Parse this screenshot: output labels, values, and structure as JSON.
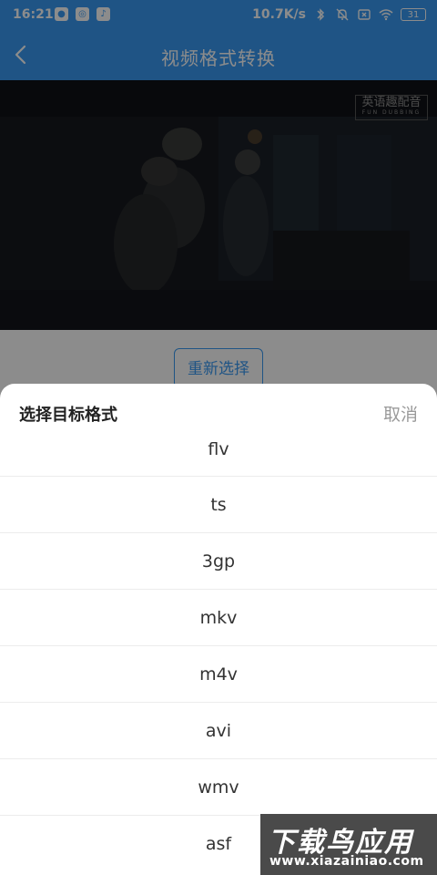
{
  "status_bar": {
    "time": "16:21",
    "network_speed": "10.7K/s",
    "battery": "31",
    "app_icons": [
      "app-icon-1",
      "app-icon-2",
      "tiktok-icon"
    ]
  },
  "app_bar": {
    "title": "视频格式转换",
    "background": "#3a9af3"
  },
  "video": {
    "watermark_main": "英语趣配音",
    "watermark_sub": "FUN DUBBING"
  },
  "reselect_button": "重新选择",
  "sheet": {
    "title": "选择目标格式",
    "cancel": "取消",
    "formats": [
      "flv",
      "ts",
      "3gp",
      "mkv",
      "m4v",
      "avi",
      "wmv",
      "asf"
    ]
  },
  "site_watermark": {
    "top": "下载鸟应用",
    "bottom": "www.xiazainiao.com"
  }
}
